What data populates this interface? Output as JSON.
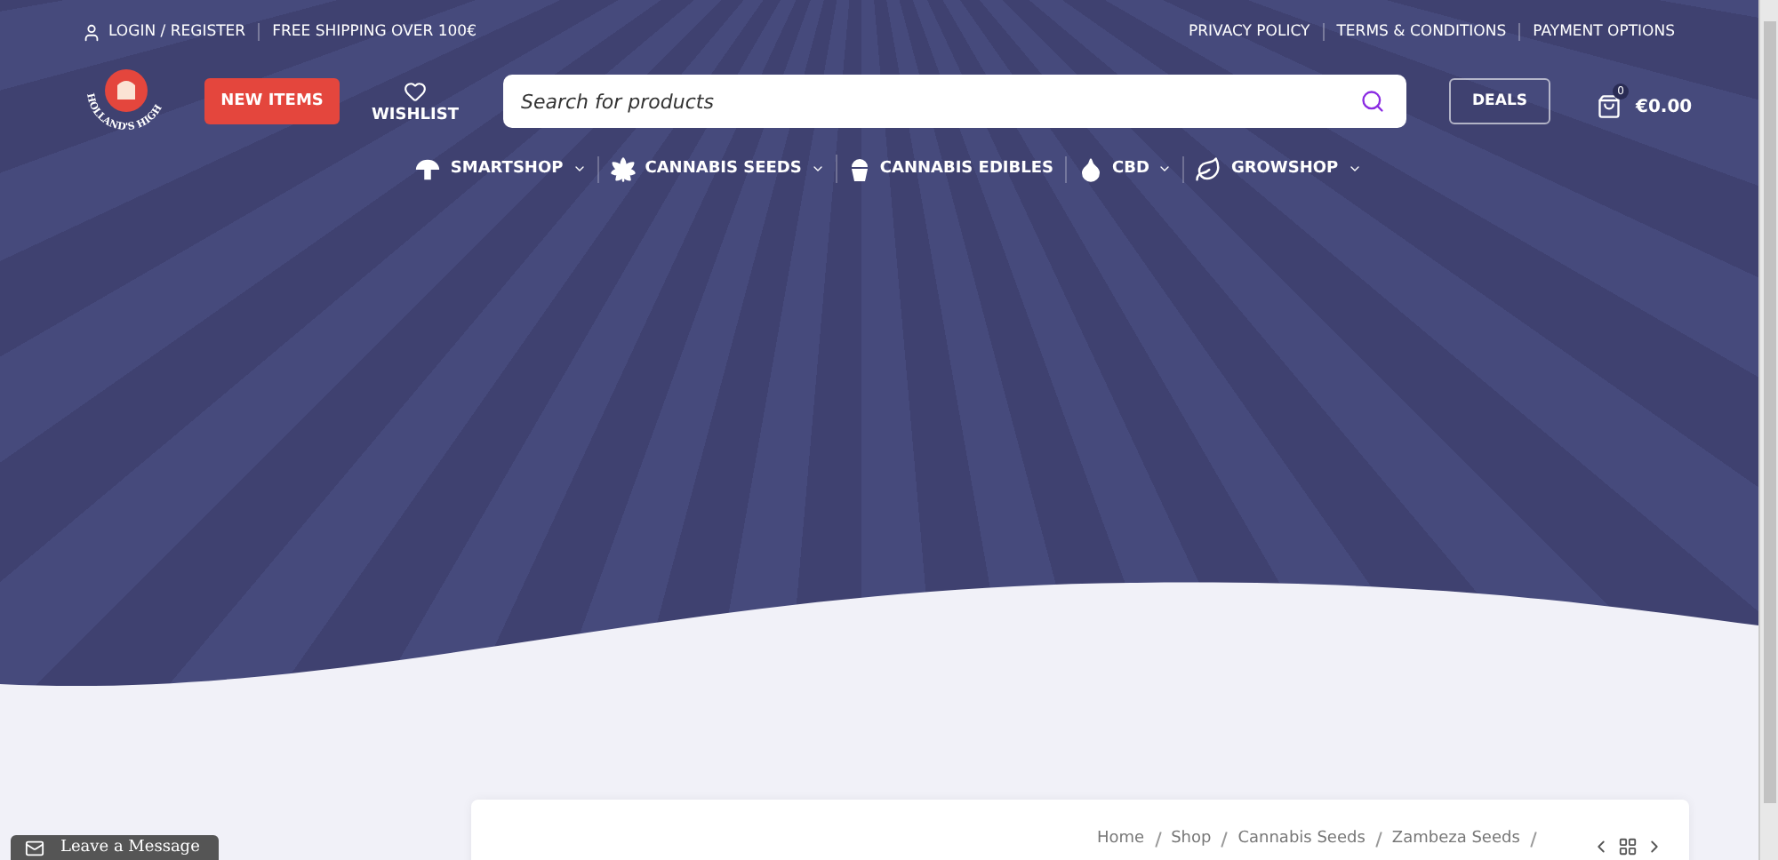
{
  "topbar": {
    "left": [
      {
        "kind": "account",
        "label": "LOGIN / REGISTER"
      },
      {
        "kind": "text",
        "label": "FREE SHIPPING OVER 100€"
      }
    ],
    "right": [
      "PRIVACY POLICY",
      "TERMS & CONDITIONS",
      "PAYMENT OPTIONS"
    ]
  },
  "header": {
    "logo": {
      "text": "HOLLAND'S HIGH"
    },
    "new_items": "NEW ITEMS",
    "wishlist": "WISHLIST",
    "search": {
      "placeholder": "Search for products"
    },
    "deals": "DEALS",
    "cart": {
      "count": "0",
      "total": "€0.00"
    }
  },
  "nav": [
    {
      "kind": "mushroom",
      "label": "SMARTSHOP",
      "has_dropdown": true
    },
    {
      "kind": "cannabis",
      "label": "CANNABIS SEEDS",
      "has_dropdown": true
    },
    {
      "kind": "cupcake",
      "label": "CANNABIS EDIBLES",
      "has_dropdown": false
    },
    {
      "kind": "drop",
      "label": "CBD",
      "has_dropdown": true
    },
    {
      "kind": "leaf",
      "label": "GROWSHOP",
      "has_dropdown": true
    }
  ],
  "breadcrumb": [
    "Home",
    "Shop",
    "Cannabis Seeds",
    "Zambeza Seeds"
  ],
  "chat": {
    "label": "Leave a Message"
  }
}
